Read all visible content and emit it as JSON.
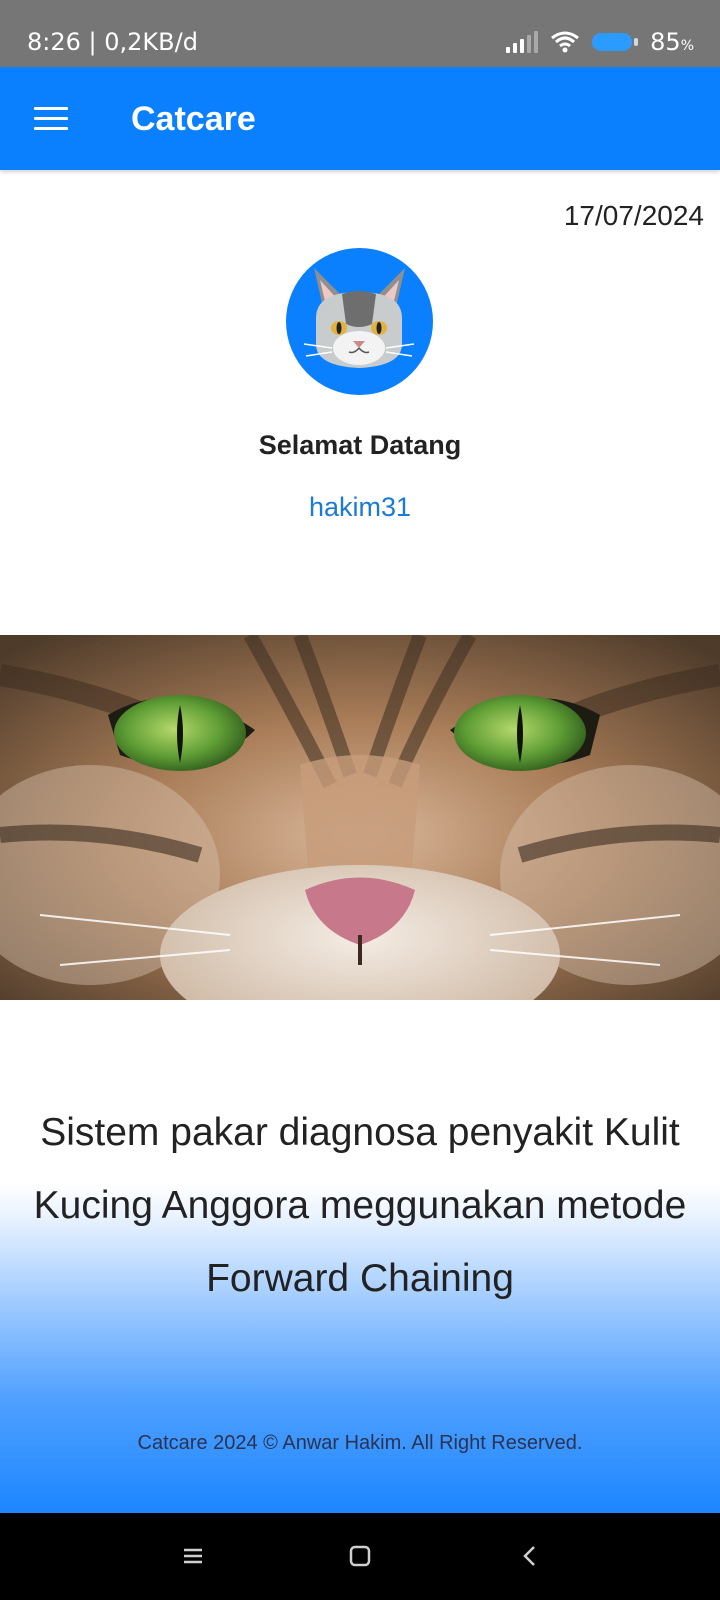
{
  "status_bar": {
    "time_and_data": "8:26 | 0,2KB/d",
    "battery_percent": "85",
    "battery_unit": "%"
  },
  "app_bar": {
    "title": "Catcare"
  },
  "home": {
    "date": "17/07/2024",
    "welcome": "Selamat Datang",
    "username": "hakim31",
    "description": "Sistem pakar diagnosa penyakit Kulit Kucing Anggora meggunakan metode Forward Chaining",
    "footer": "Catcare 2024 © Anwar Hakim. All Right Reserved."
  },
  "colors": {
    "primary": "#0a80ff",
    "status_bar": "#767676",
    "username": "#1a7ad6"
  },
  "icons": [
    "menu-icon",
    "signal-icon",
    "wifi-icon",
    "battery-icon",
    "cat-avatar-icon",
    "nav-recents-icon",
    "nav-home-icon",
    "nav-back-icon"
  ]
}
